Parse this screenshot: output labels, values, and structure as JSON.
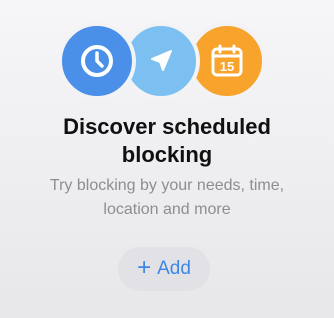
{
  "colors": {
    "clock": "#4a90e8",
    "location": "#7cc0f2",
    "calendar": "#f7a32c",
    "accent": "#3f86e6"
  },
  "icons": {
    "clock": "clock-icon",
    "location": "location-arrow-icon",
    "calendar": "calendar-icon",
    "plus": "plus-icon"
  },
  "calendar": {
    "day": "15"
  },
  "title": {
    "line1": "Discover scheduled",
    "line2": "blocking"
  },
  "subtitle": {
    "line1": "Try blocking by your needs, time,",
    "line2": "location and more"
  },
  "add_button": {
    "plus": "+",
    "label": "Add"
  }
}
